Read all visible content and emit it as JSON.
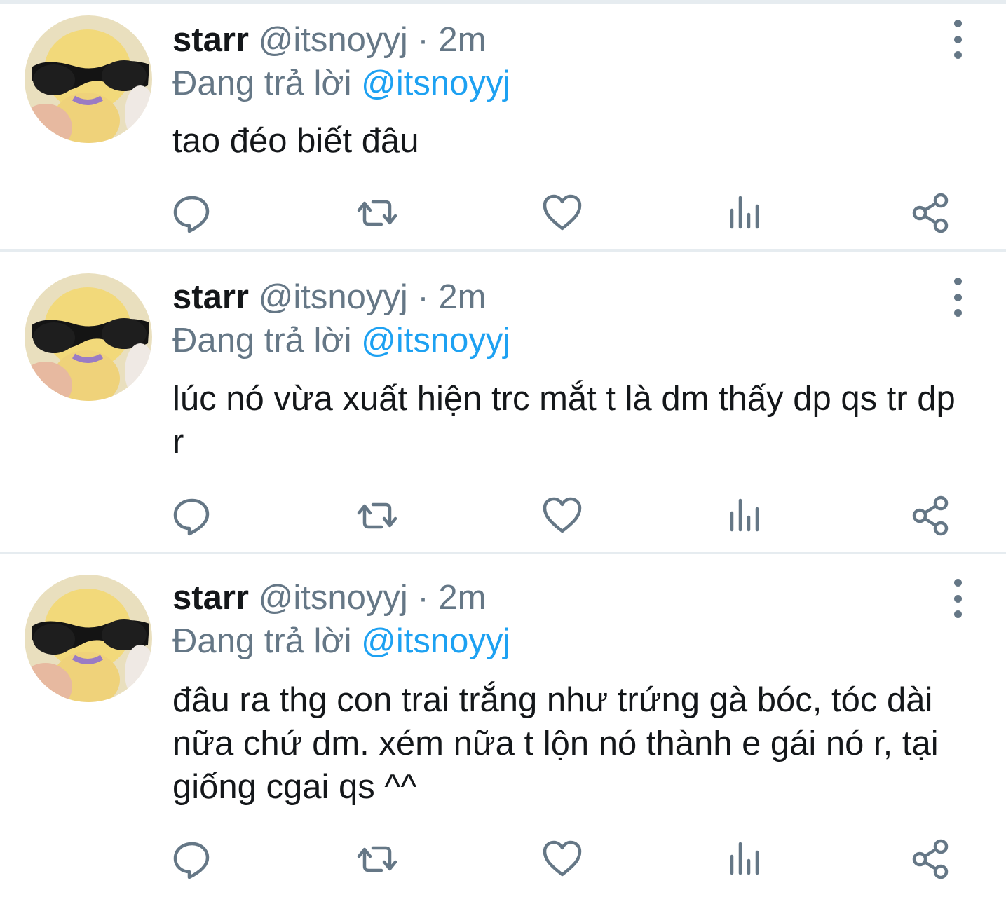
{
  "colors": {
    "text_primary": "#14171a",
    "text_secondary": "#657786",
    "accent": "#1da1f2",
    "divider": "#e6ecf0"
  },
  "tweets": [
    {
      "display_name": "starr",
      "handle": "@itsnoyyj",
      "separator": "·",
      "time": "2m",
      "reply_prefix": "Đang trả lời",
      "reply_to": "@itsnoyyj",
      "text": "tao đéo biết đâu"
    },
    {
      "display_name": "starr",
      "handle": "@itsnoyyj",
      "separator": "·",
      "time": "2m",
      "reply_prefix": "Đang trả lời",
      "reply_to": "@itsnoyyj",
      "text": "lúc nó vừa xuất hiện trc mắt t là dm thấy dp qs tr dp r"
    },
    {
      "display_name": "starr",
      "handle": "@itsnoyyj",
      "separator": "·",
      "time": "2m",
      "reply_prefix": "Đang trả lời",
      "reply_to": "@itsnoyyj",
      "text": "đâu ra thg con trai trắng như trứng gà bóc, tóc dài nữa chứ dm. xém nữa t lộn nó thành e gái nó r, tại giống cgai qs ^^"
    }
  ],
  "actions": [
    "reply-icon",
    "retweet-icon",
    "like-icon",
    "analytics-icon",
    "share-icon"
  ],
  "avatar_icon": "avatar-duck-sunglasses",
  "more_icon": "more-vertical-icon"
}
